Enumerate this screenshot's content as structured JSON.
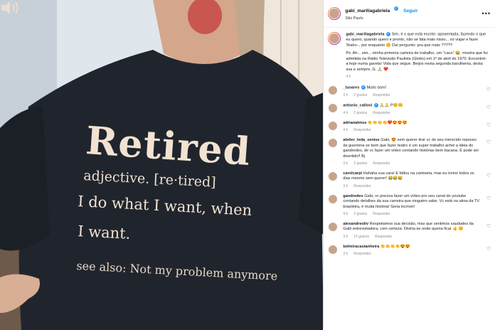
{
  "post": {
    "shirt": {
      "headline": "Retired",
      "definition": "adjective. [re·tired]",
      "line1": "I do what I want, when",
      "line2": "I want.",
      "see_also": "see also: Not my problem anymore"
    }
  },
  "header": {
    "username": "gabi_mariliagabriela",
    "follow_label": "Seguir",
    "location": "São Paulo",
    "more_icon": "•••"
  },
  "caption": {
    "username": "gabi_mariliagabriela",
    "text": "Sim, é o que está escrito: aposentada, fazendo o que eu quero, quando quero e pronto, não se fala mais nisso... só viajar e fazer Teatro... por enquanto 😊 Daí pergunto: pra que mais ?????",
    "text2": "Ps. Ah... sim... minha primeira carteira de trabalho, um \"caco\" 😂, mostra que fui admitida na Rádio Televisão Paulista (Globo) em 1º de abril de 1970. Encontrei-a hoje numa gaveta! Vida que segue. Beijos nesta segunda barulhenta, desta sua e sempre, G. 🙏 ❤️",
    "time": "4 h"
  },
  "comments": [
    {
      "user": "_tsoares",
      "verified": true,
      "text": "Muito bom!",
      "time": "3 h",
      "likes": "2 gostos",
      "reply": "Responder"
    },
    {
      "user": "antonio_calloni",
      "verified": true,
      "text": "🙏🙏 P😊😊",
      "time": "4 h",
      "likes": "2 gostos",
      "reply": "Responder"
    },
    {
      "user": "adrianatmss",
      "verified": false,
      "text": "👏👏👏👏❤️😍😍😍",
      "time": "4 h",
      "likes": "",
      "reply": "Responder"
    },
    {
      "user": "atelier_leda_senise",
      "verified": false,
      "text": "Gabi, 😍 sem querer tirar vc do seu merecido repouso da guerreira se bem que fazer teatro é um super trabalho achei a ideia do gandredes, de vc fazer um vídeo contando histórias bem bacana. É pode ser divertido!! Bj",
      "time": "3 h",
      "likes": "2 gostos",
      "reply": "Responder"
    },
    {
      "user": "carolcarpi",
      "verified": false,
      "text": "Hahaha sua cara! E faltou na camiseta, mas eu treino todos os dias mesmo sem querer! 😂😂😂",
      "time": "3 h",
      "likes": "",
      "reply": "Responder"
    },
    {
      "user": "gandredes",
      "verified": false,
      "text": "Gabi, vc precisa fazer um vídeo pro seu canal do youtube contando detalhes da sua carreira que ninguém sabe. Vc está na alma da TV brasileira, é muita história! Seria incrível!",
      "time": "4 h",
      "likes": "2 gostos",
      "reply": "Responder"
    },
    {
      "user": "alexandreoliv",
      "verified": false,
      "text": "Respeitamos sua decisão, mas que sentimos saudades da Gabi entrevistadora, com certeza. Divirta-se onde queira ficar 👍 😊",
      "time": "3 h",
      "likes": "15 gostos",
      "reply": "Responder"
    },
    {
      "user": "belmiracastanheira",
      "verified": false,
      "text": "👏👏👏👏😍😍",
      "time": "3 h",
      "likes": "",
      "reply": "Responder"
    }
  ],
  "colors": {
    "shirt": "#20252d",
    "link": "#0095f6",
    "verified": "#3897f0"
  }
}
